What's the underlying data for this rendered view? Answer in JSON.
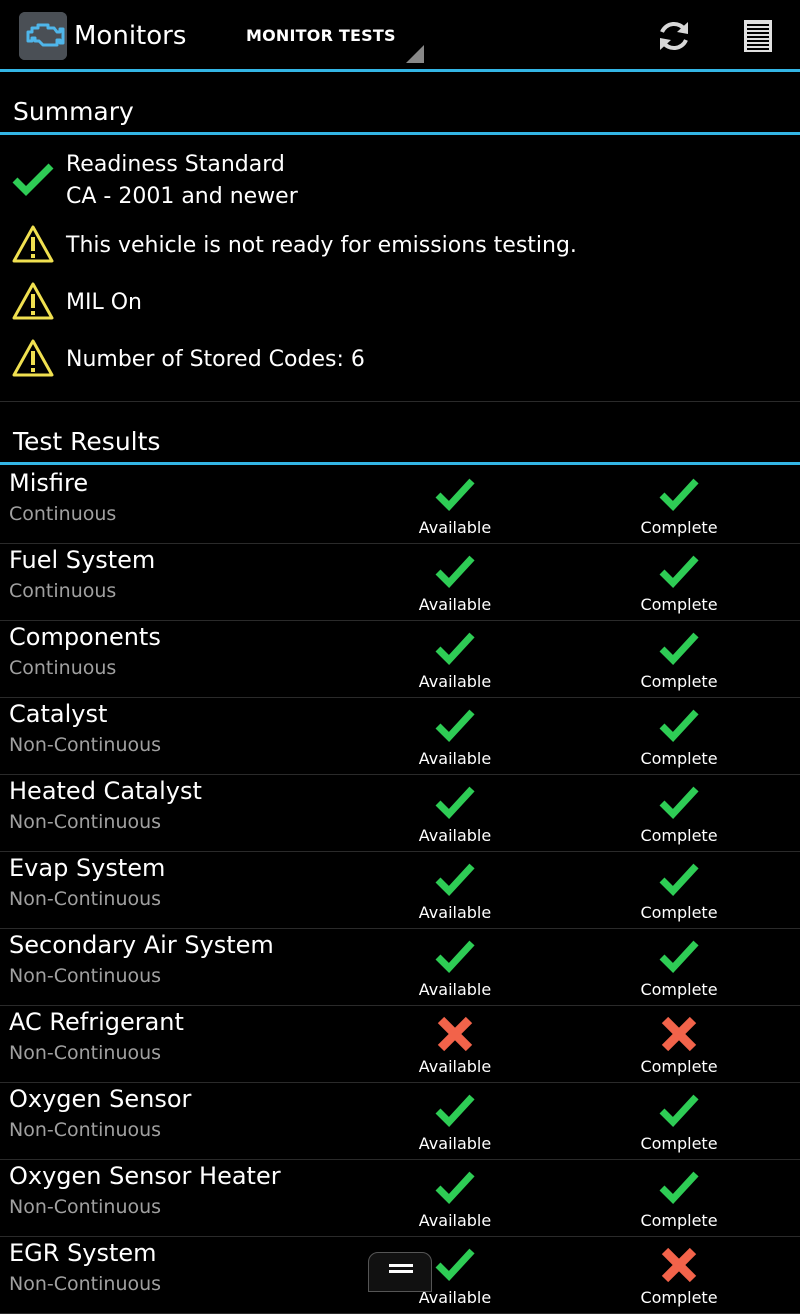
{
  "app": {
    "title": "Monitors",
    "icon": "engine-icon",
    "accent": "#33b5e5"
  },
  "toolbar": {
    "spinner_label": "MONITOR TESTS",
    "refresh_icon": "refresh-icon",
    "menu_icon": "list-icon"
  },
  "summary": {
    "header": "Summary",
    "readiness_line1": "Readiness Standard",
    "readiness_line2": "CA - 2001 and newer",
    "items": [
      "This vehicle is not ready for emissions testing.",
      "MIL On",
      "Number of Stored Codes: 6"
    ]
  },
  "results": {
    "header": "Test Results",
    "available_label": "Available",
    "complete_label": "Complete",
    "rows": [
      {
        "name": "Misfire",
        "type": "Continuous",
        "available": true,
        "complete": true
      },
      {
        "name": "Fuel System",
        "type": "Continuous",
        "available": true,
        "complete": true
      },
      {
        "name": "Components",
        "type": "Continuous",
        "available": true,
        "complete": true
      },
      {
        "name": "Catalyst",
        "type": "Non-Continuous",
        "available": true,
        "complete": true
      },
      {
        "name": "Heated Catalyst",
        "type": "Non-Continuous",
        "available": true,
        "complete": true
      },
      {
        "name": "Evap System",
        "type": "Non-Continuous",
        "available": true,
        "complete": true
      },
      {
        "name": "Secondary Air System",
        "type": "Non-Continuous",
        "available": true,
        "complete": true
      },
      {
        "name": "AC Refrigerant",
        "type": "Non-Continuous",
        "available": false,
        "complete": false
      },
      {
        "name": "Oxygen Sensor",
        "type": "Non-Continuous",
        "available": true,
        "complete": true
      },
      {
        "name": "Oxygen Sensor Heater",
        "type": "Non-Continuous",
        "available": true,
        "complete": true
      },
      {
        "name": "EGR System",
        "type": "Non-Continuous",
        "available": true,
        "complete": false
      }
    ]
  },
  "colors": {
    "ok": "#2ecc55",
    "fail": "#f2634a",
    "warn": "#f0e050"
  }
}
